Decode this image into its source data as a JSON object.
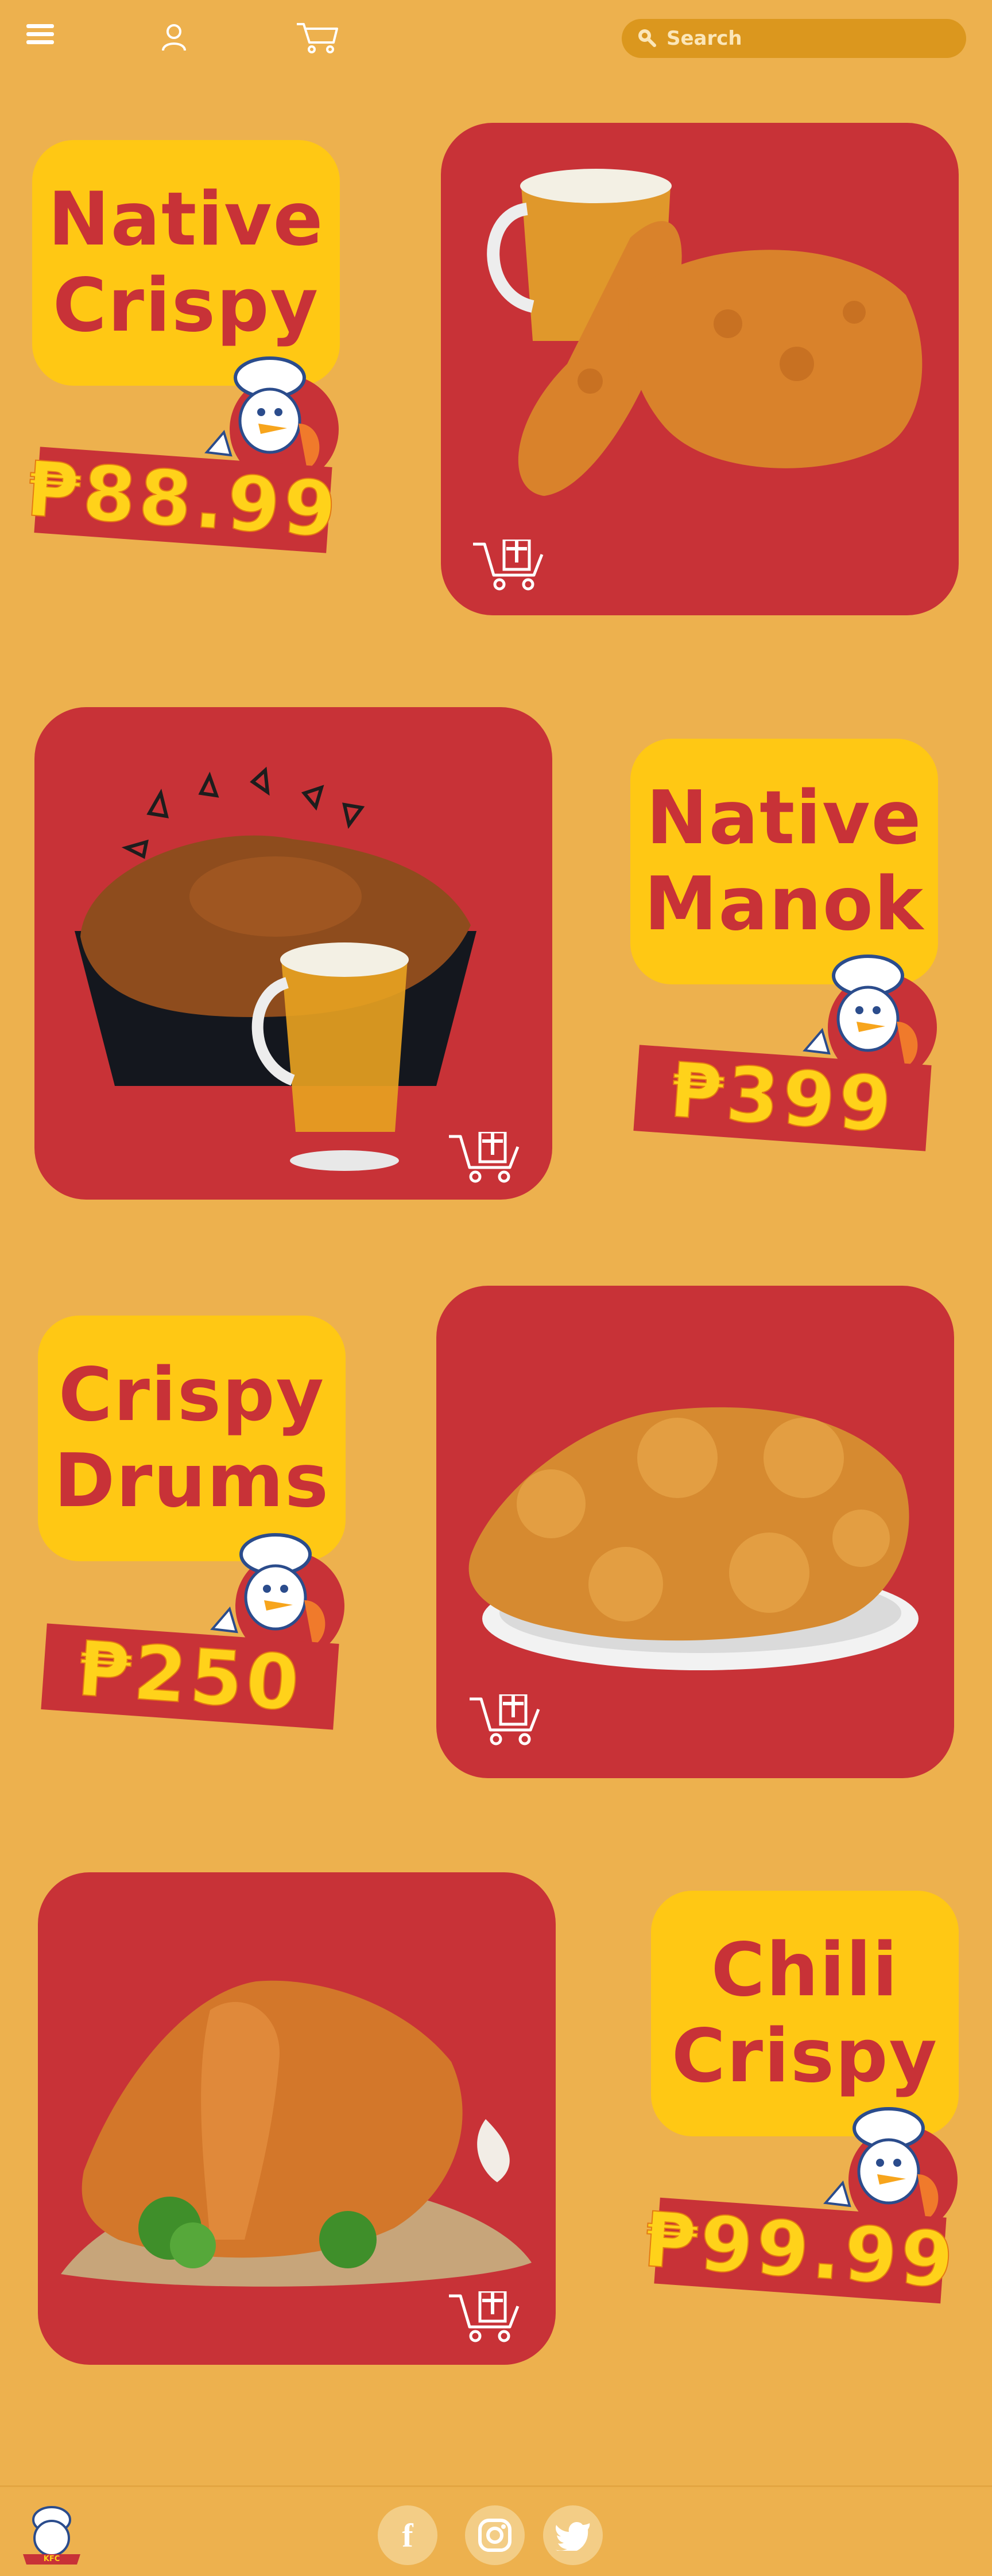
{
  "header": {
    "search_placeholder": "Search"
  },
  "products": [
    {
      "name_line1": "Native",
      "name_line2": "Crispy",
      "price": "₱88.99"
    },
    {
      "name_line1": "Native",
      "name_line2": "Manok",
      "price": "₱399"
    },
    {
      "name_line1": "Crispy",
      "name_line2": "Drums",
      "price": "₱250"
    },
    {
      "name_line1": "Chili",
      "name_line2": "Crispy",
      "price": "₱99.99"
    }
  ],
  "footer": {
    "logo_text": "Kylie's Fried Chicken",
    "facebook_glyph": "f"
  },
  "colors": {
    "background": "#EDB14E",
    "card_red": "#C83237",
    "name_yellow": "#FFC814",
    "search_bg": "#DB971E"
  },
  "icons": [
    "menu-icon",
    "user-icon",
    "cart-icon",
    "search-icon",
    "add-to-cart-icon",
    "facebook-icon",
    "instagram-icon",
    "twitter-icon"
  ]
}
